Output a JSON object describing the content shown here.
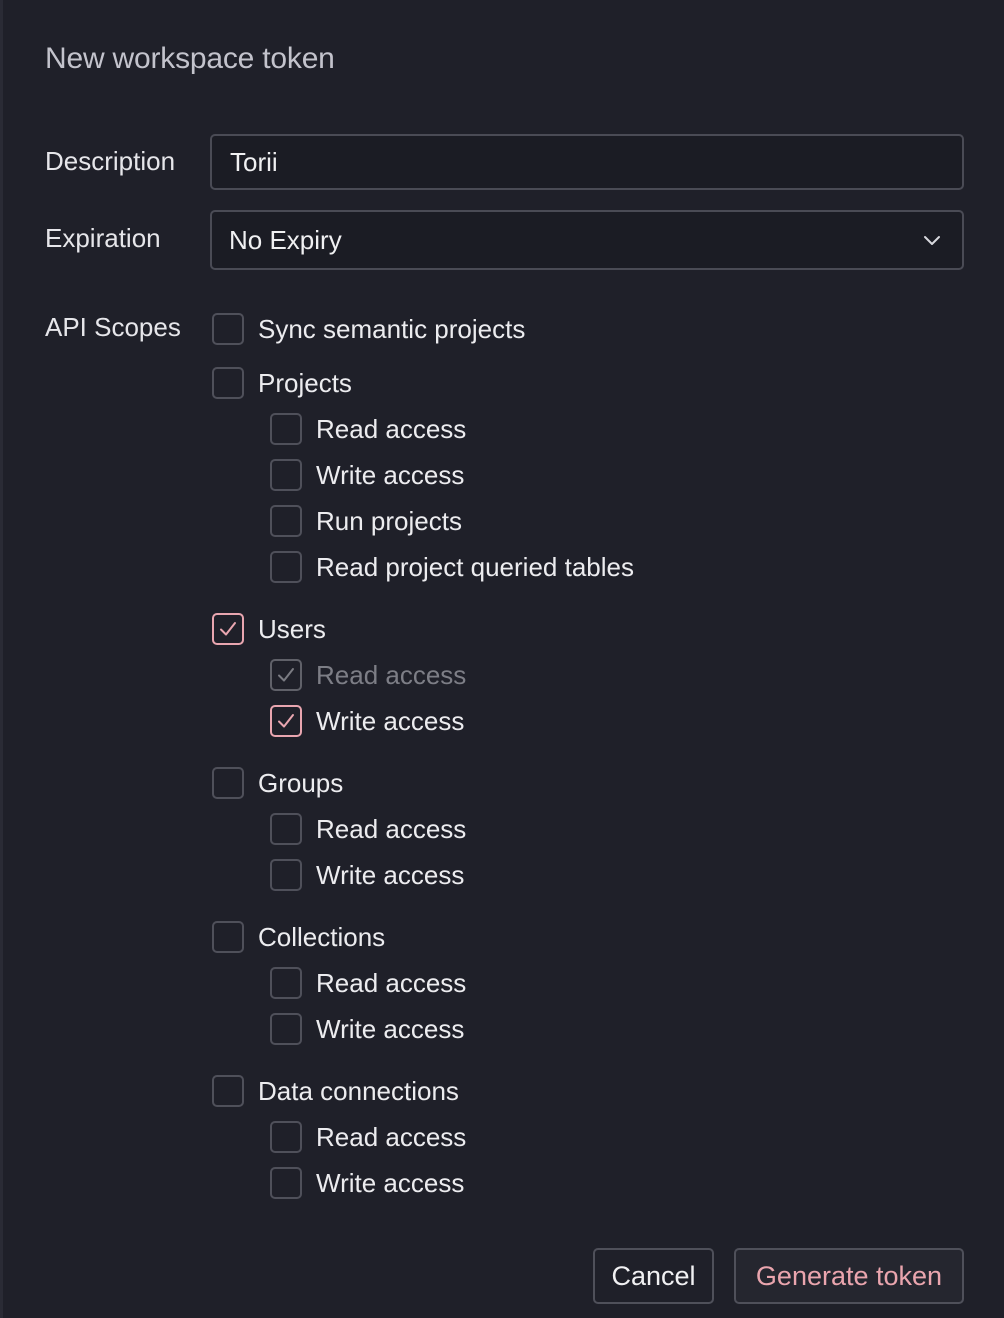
{
  "dialog": {
    "title": "New workspace token"
  },
  "form": {
    "description_label": "Description",
    "description_value": "Torii",
    "expiration_label": "Expiration",
    "expiration_value": "No Expiry",
    "scopes_label": "API Scopes"
  },
  "scopes": [
    {
      "label": "Sync semantic projects",
      "checked": false,
      "disabled": false,
      "level": 0
    },
    {
      "label": "Projects",
      "checked": false,
      "disabled": false,
      "level": 0
    },
    {
      "label": "Read access",
      "checked": false,
      "disabled": false,
      "level": 1
    },
    {
      "label": "Write access",
      "checked": false,
      "disabled": false,
      "level": 1
    },
    {
      "label": "Run projects",
      "checked": false,
      "disabled": false,
      "level": 1
    },
    {
      "label": "Read project queried tables",
      "checked": false,
      "disabled": false,
      "level": 1
    },
    {
      "label": "Users",
      "checked": true,
      "disabled": false,
      "level": 0
    },
    {
      "label": "Read access",
      "checked": true,
      "disabled": true,
      "level": 1
    },
    {
      "label": "Write access",
      "checked": true,
      "disabled": false,
      "level": 1
    },
    {
      "label": "Groups",
      "checked": false,
      "disabled": false,
      "level": 0
    },
    {
      "label": "Read access",
      "checked": false,
      "disabled": false,
      "level": 1
    },
    {
      "label": "Write access",
      "checked": false,
      "disabled": false,
      "level": 1
    },
    {
      "label": "Collections",
      "checked": false,
      "disabled": false,
      "level": 0
    },
    {
      "label": "Read access",
      "checked": false,
      "disabled": false,
      "level": 1
    },
    {
      "label": "Write access",
      "checked": false,
      "disabled": false,
      "level": 1
    },
    {
      "label": "Data connections",
      "checked": false,
      "disabled": false,
      "level": 0
    },
    {
      "label": "Read access",
      "checked": false,
      "disabled": false,
      "level": 1
    },
    {
      "label": "Write access",
      "checked": false,
      "disabled": false,
      "level": 1
    }
  ],
  "actions": {
    "cancel_label": "Cancel",
    "generate_label": "Generate token"
  },
  "colors": {
    "background": "#1f2029",
    "accent": "#e9a6b0",
    "border": "#4f505a"
  },
  "icons": {
    "select": "chevron-down-icon",
    "check": "checkmark-icon"
  }
}
